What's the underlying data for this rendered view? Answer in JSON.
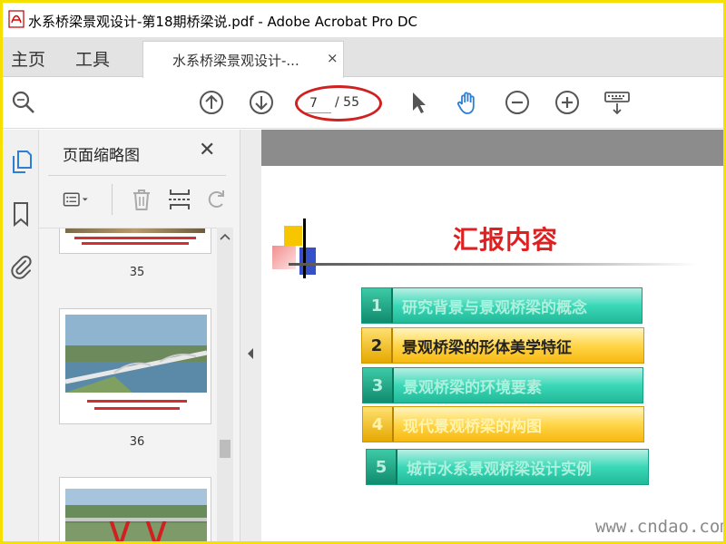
{
  "window": {
    "title": "水系桥梁景观设计-第18期桥梁说.pdf - Adobe Acrobat Pro DC"
  },
  "nav": {
    "home": "主页",
    "tools": "工具"
  },
  "doc_tab": {
    "label": "水系桥梁景观设计-...",
    "close": "×"
  },
  "toolbar": {
    "current_page": "7",
    "total_pages": "/ 55",
    "icons": [
      "zoom-search-icon",
      "page-up-icon",
      "page-down-icon",
      "select-arrow-icon",
      "hand-icon",
      "zoom-out-icon",
      "zoom-in-icon",
      "keyboard-icon"
    ]
  },
  "rail": {
    "icons": [
      "page-thumbnails-icon",
      "bookmark-icon",
      "attachment-icon"
    ]
  },
  "thumb_panel": {
    "title": "页面缩略图",
    "close": "✕",
    "pages": [
      {
        "number": "35"
      },
      {
        "number": "36"
      }
    ]
  },
  "slide": {
    "title": "汇报内容",
    "items": [
      {
        "num": "1",
        "label": "研究背景与景观桥梁的概念",
        "style": "teal"
      },
      {
        "num": "2",
        "label": "景观桥梁的形体美学特征",
        "style": "yellow"
      },
      {
        "num": "3",
        "label": "景观桥梁的环境要素",
        "style": "teal"
      },
      {
        "num": "4",
        "label": "现代景观桥梁的构图",
        "style": "yellow"
      },
      {
        "num": "5",
        "label": "城市水系景观桥梁设计实例",
        "style": "teal"
      }
    ]
  },
  "watermark": "www.cndao.com",
  "colors": {
    "frame": "#f5e000",
    "accent_red": "#e02020",
    "teal": "#3bd8b8",
    "yellow": "#ffd64a",
    "hand_tool_active": "#2c7ed6"
  }
}
